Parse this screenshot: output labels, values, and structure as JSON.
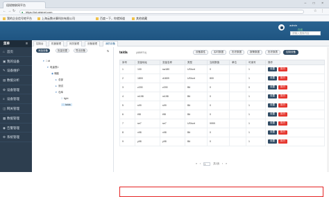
{
  "browser": {
    "tab_title": "纽锐物联网平台",
    "address": "https://iot.wtsinet.com",
    "bookmarks": [
      "我的企业信号地平台",
      "上海云数计算科技有限公司",
      "百度一下，你就知道",
      "其他收藏"
    ]
  },
  "header": {
    "username": "admin",
    "status": "在线",
    "search_placeholder": "请输入搜索内容"
  },
  "sidebar": {
    "title": "菜单",
    "items": [
      {
        "label": "首页",
        "icon": "home-icon",
        "glyph": "⌂"
      },
      {
        "label": "我的设备",
        "icon": "device-icon",
        "glyph": "▣"
      },
      {
        "label": "设备维护",
        "icon": "wrench-icon",
        "glyph": "✎"
      },
      {
        "label": "数据分析",
        "icon": "chart-icon",
        "glyph": "▤"
      },
      {
        "label": "设备管理",
        "icon": "gear-icon",
        "glyph": "⚙"
      },
      {
        "label": "设备管理",
        "icon": "list-icon",
        "glyph": "≡"
      },
      {
        "label": "网关管理",
        "icon": "gateway-icon",
        "glyph": "◫"
      },
      {
        "label": "数据管理",
        "icon": "database-icon",
        "glyph": "▦"
      },
      {
        "label": "告警管理",
        "icon": "bell-icon",
        "glyph": "◉"
      },
      {
        "label": "系统管理",
        "icon": "settings-icon",
        "glyph": "⚙"
      }
    ]
  },
  "page_tabs": [
    "控制台",
    "机器管理",
    "网关管理",
    "设备管理",
    "我的设备"
  ],
  "tree": {
    "buttons": [
      "添加设备",
      "批量设置",
      "导出设备"
    ],
    "nodes": [
      {
        "label": "□ dt",
        "indent": 0
      },
      {
        "label": "电量表1",
        "indent": 1
      },
      {
        "label": "储能",
        "indent": 2
      },
      {
        "label": "总部",
        "indent": 3
      },
      {
        "label": "测试",
        "indent": 3
      },
      {
        "label": "仓库",
        "indent": 3
      },
      {
        "label": "light",
        "indent": 4
      },
      {
        "label": "taida",
        "indent": 4
      }
    ]
  },
  "device": {
    "name": "taida",
    "subtitle": "(485RTU)",
    "actions": [
      "设备属性",
      "实时数据",
      "历史数据",
      "报警数据",
      "历史报表",
      "控制设备"
    ]
  },
  "table": {
    "headers": [
      "序号",
      "变量地址",
      "变量名称",
      "类型",
      "当前数值",
      "单位",
      "可读写",
      "操作"
    ],
    "rows": [
      [
        "1",
        "100",
        "sw180",
        "UShort",
        "0",
        "",
        "1",
        "设置",
        "执行"
      ],
      [
        "2",
        "1800",
        "d1809",
        "UShort",
        "800",
        "",
        "1",
        "设置",
        "执行"
      ],
      [
        "3",
        "z200",
        "z200",
        "Bit",
        "0",
        "",
        "0",
        "设置",
        "执行"
      ],
      [
        "4",
        "m198",
        "m198",
        "Bit",
        "0",
        "",
        "1",
        "设置",
        "执行"
      ],
      [
        "5",
        "s99",
        "s99",
        "Bit",
        "0",
        "",
        "1",
        "设置",
        "执行"
      ],
      [
        "6",
        "t98",
        "t98",
        "Bit",
        "0",
        "",
        "1",
        "设置",
        "执行"
      ],
      [
        "7",
        "se7",
        "se7",
        "UShort",
        "9999",
        "",
        "1",
        "设置",
        "执行"
      ],
      [
        "8",
        "x98",
        "x98",
        "Bit",
        "0",
        "",
        "1",
        "设置",
        "执行"
      ],
      [
        "9",
        "y98",
        "y98",
        "Bit",
        "0",
        "",
        "1",
        "设置",
        "执行"
      ]
    ]
  },
  "pager": {
    "first": "«",
    "prev": "‹",
    "page": "1",
    "of": "共1页",
    "next": "›",
    "last": "»"
  }
}
